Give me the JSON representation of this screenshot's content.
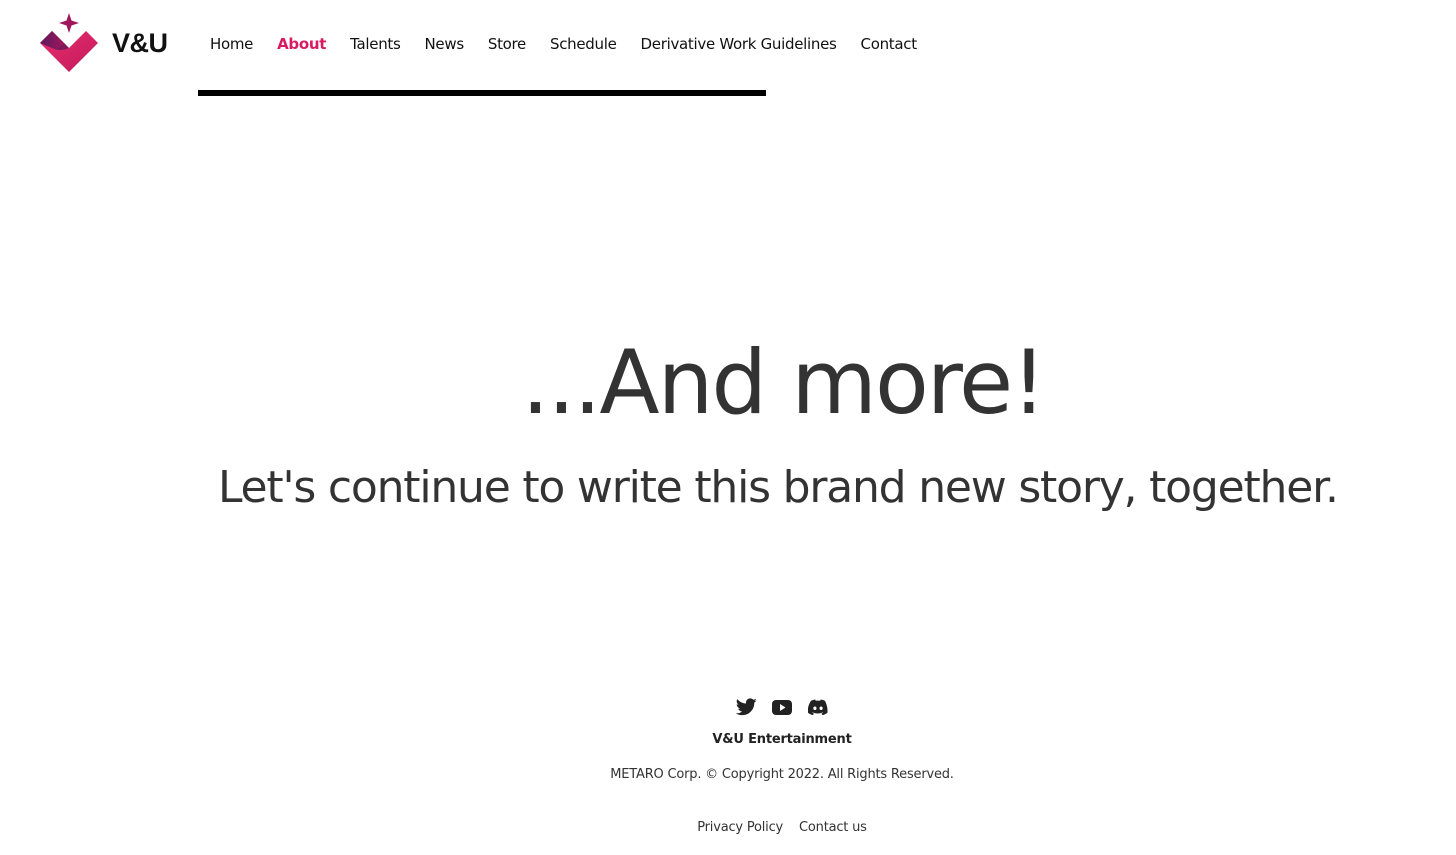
{
  "brand": {
    "logo_text": "V&U",
    "accent_color": "#d81b60",
    "logo_icon": "heart-diamond-sparkle-logo"
  },
  "nav": {
    "items": [
      {
        "label": "Home",
        "active": false
      },
      {
        "label": "About",
        "active": true
      },
      {
        "label": "Talents",
        "active": false
      },
      {
        "label": "News",
        "active": false
      },
      {
        "label": "Store",
        "active": false
      },
      {
        "label": "Schedule",
        "active": false
      },
      {
        "label": "Derivative Work Guidelines",
        "active": false
      },
      {
        "label": "Contact",
        "active": false
      }
    ],
    "active_color": "#d81b60"
  },
  "hero": {
    "title": "...And more!",
    "subtitle": "Let's continue to write this brand new story, together."
  },
  "footer": {
    "social": [
      {
        "icon": "twitter-icon"
      },
      {
        "icon": "youtube-icon"
      },
      {
        "icon": "discord-icon"
      }
    ],
    "brand_name": "V&U Entertainment",
    "copyright": "METARO Corp. © Copyright 2022. All Rights Reserved.",
    "links": {
      "privacy": "Privacy Policy",
      "contact": "Contact us"
    }
  }
}
